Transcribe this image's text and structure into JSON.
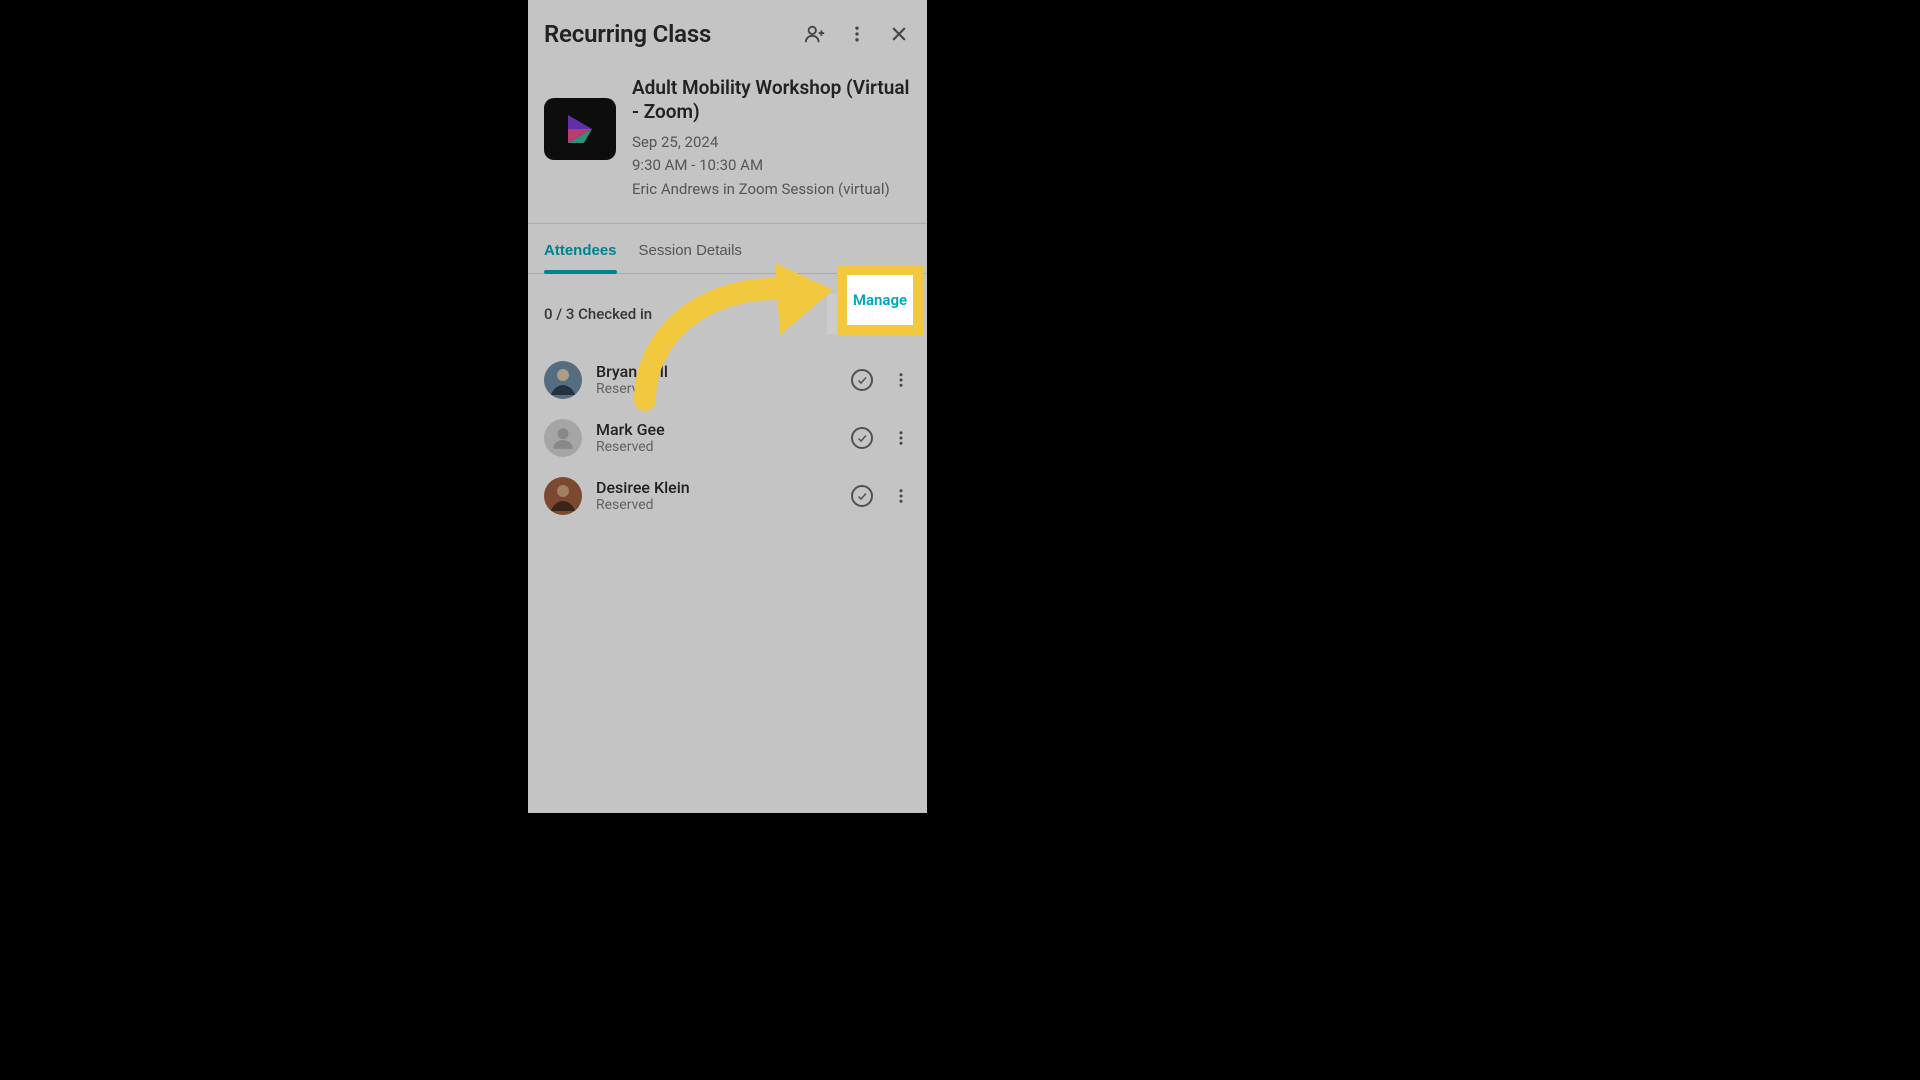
{
  "header": {
    "title": "Recurring Class"
  },
  "session": {
    "name": "Adult Mobility Workshop (Virtual - Zoom)",
    "date": "Sep 25, 2024",
    "time": "9:30 AM - 10:30 AM",
    "instructor_location": "Eric Andrews in Zoom Session (virtual)"
  },
  "tabs": {
    "attendees": "Attendees",
    "session_details": "Session Details"
  },
  "checkin": {
    "status": "0 / 3 Checked in",
    "manage_label": "Manage"
  },
  "attendees": [
    {
      "name": "Bryan Bell",
      "status": "Reserved",
      "avatar_bg": "#6b89a0"
    },
    {
      "name": "Mark Gee",
      "status": "Reserved",
      "avatar_bg": "placeholder"
    },
    {
      "name": "Desiree Klein",
      "status": "Reserved",
      "avatar_bg": "#9a5a3e"
    }
  ],
  "annotation": {
    "highlight_label": "Manage"
  }
}
